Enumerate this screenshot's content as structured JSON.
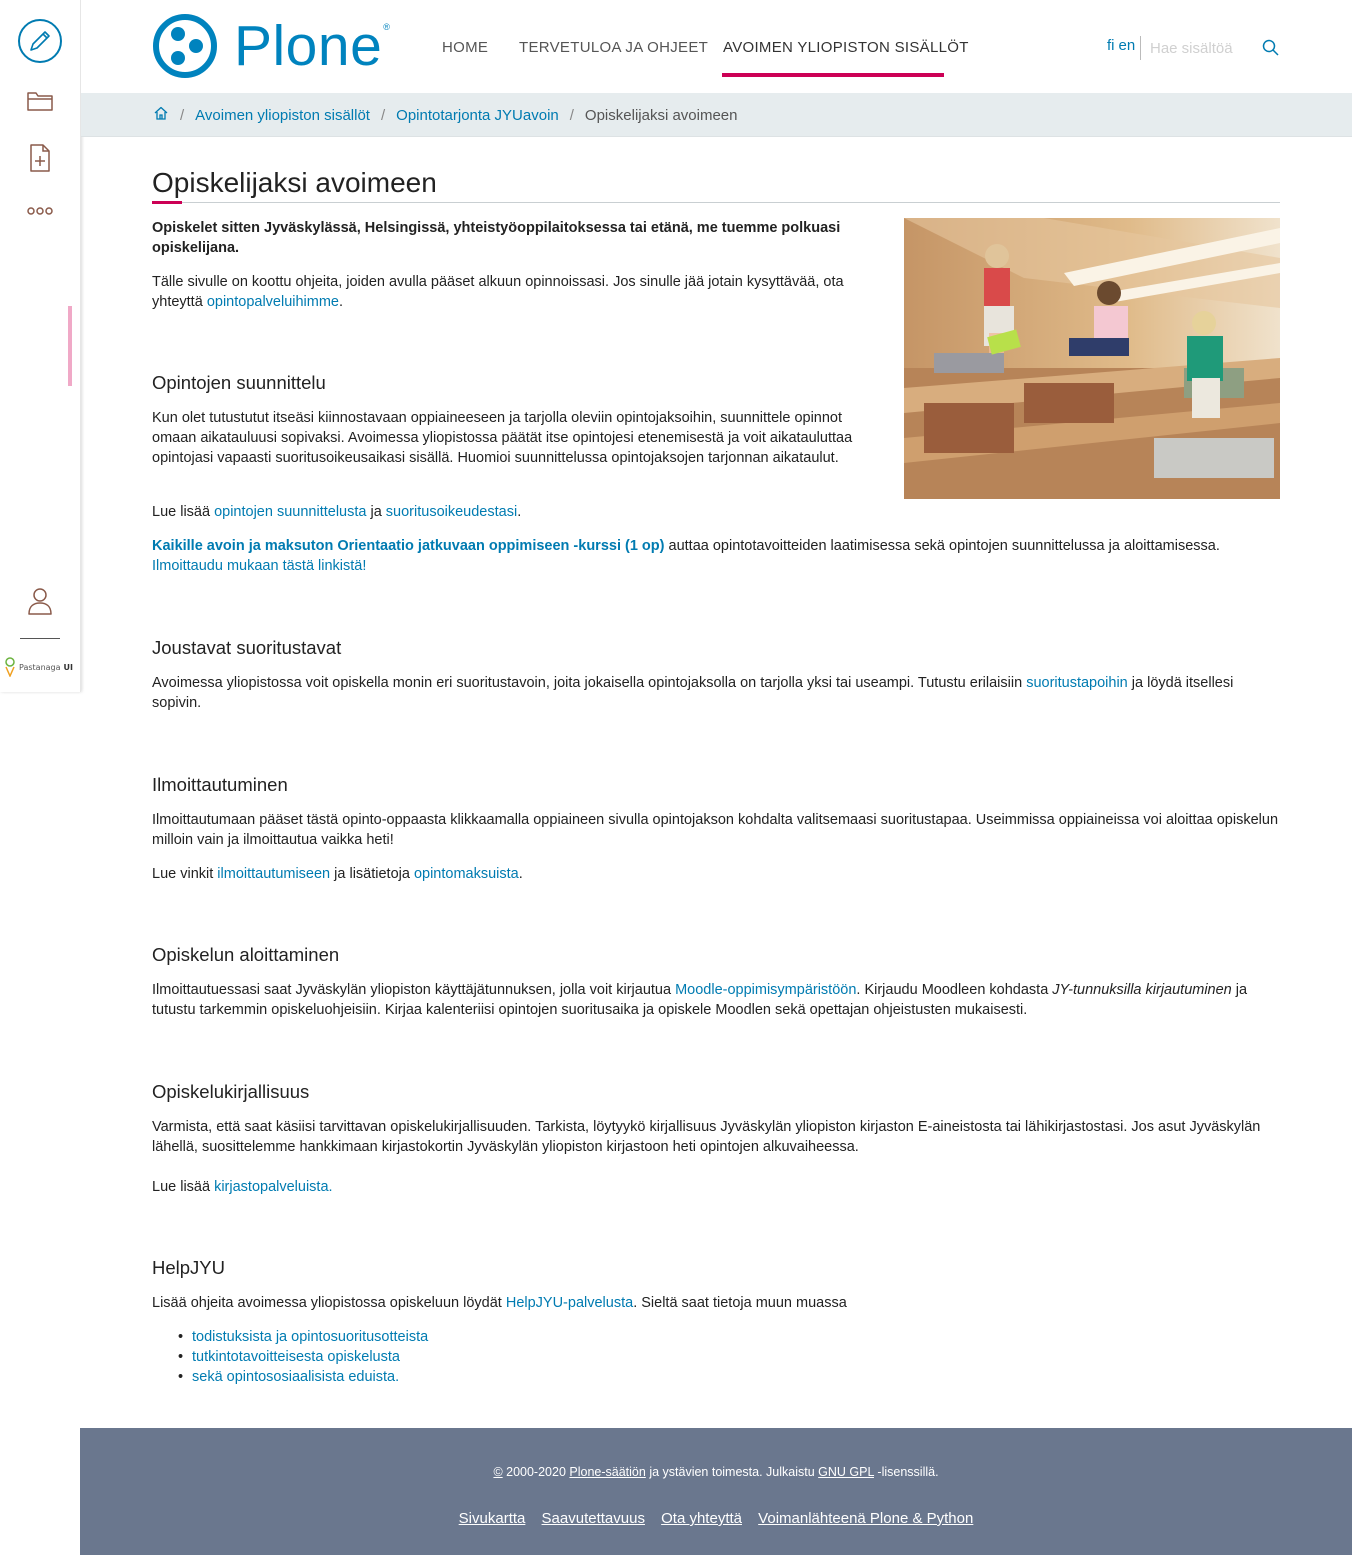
{
  "brand": {
    "name": "Plone",
    "reg": "®"
  },
  "toolbar": {
    "brand_prefix": "Pastanaga",
    "brand_suffix": "UI"
  },
  "nav": {
    "home": "HOME",
    "welcome": "TERVETULOA JA OHJEET",
    "open": "AVOIMEN YLIOPISTON SISÄLLÖT"
  },
  "lang": {
    "fi": "fi",
    "en": "en"
  },
  "search": {
    "placeholder": "Hae sisältöä"
  },
  "breadcrumb": {
    "items": [
      "Avoimen yliopiston sisällöt",
      "Opintotarjonta JYUavoin"
    ],
    "current": "Opiskelijaksi avoimeen"
  },
  "page": {
    "title": "Opiskelijaksi avoimeen",
    "lead": "Opiskelet sitten Jyväskylässä, Helsingissä, yhteistyöoppilaitoksessa tai etänä, me tuemme polkuasi opiskelijana.",
    "intro": {
      "text": "Tälle sivulle on koottu ohjeita, joiden avulla pääset alkuun opinnoissasi. Jos sinulle jää jotain kysyttävää, ota yhteyttä ",
      "link": "opintopalveluihimme",
      "end": "."
    },
    "s1": {
      "heading": "Opintojen suunnittelu",
      "p1": "Kun olet tutustutut itseäsi kiinnostavaan oppiaineeseen ja tarjolla oleviin opintojaksoihin, suunnittele opinnot omaan aikatauluusi sopivaksi. Avoimessa yliopistossa päätät itse opintojesi etenemisestä ja voit aikatauluttaa opintojasi vapaasti suoritusoikeusaikasi sisällä. Huomioi suunnittelussa opintojaksojen tarjonnan aikataulut.",
      "p2_a": "Lue lisää ",
      "p2_link1": "opintojen suunnittelusta",
      "p2_b": " ja ",
      "p2_link2": "suoritusoikeudestasi",
      "p2_c": ".",
      "p3_link_bold": "Kaikille avoin ja maksuton Orientaatio jatkuvaan oppimiseen -kurssi (1 op)",
      "p3_a": " auttaa opintotavoitteiden laatimisessa sekä opintojen suunnittelussa ja aloittamisessa. ",
      "p3_link2": "Ilmoittaudu mukaan tästä linkistä!"
    },
    "s2": {
      "heading": "Joustavat suoritustavat",
      "p1_a": "Avoimessa yliopistossa voit opiskella monin eri suoritustavoin, joita jokaisella opintojaksolla on tarjolla yksi tai useampi. Tutustu erilaisiin ",
      "p1_link": "suoritustapoihin",
      "p1_b": " ja löydä itsellesi sopivin."
    },
    "s3": {
      "heading": "Ilmoittautuminen",
      "p1": "Ilmoittautumaan pääset tästä opinto-oppaasta klikkaamalla oppiaineen sivulla opintojakson kohdalta valitsemaasi suoritustapaa. Useimmissa oppiaineissa voi aloittaa opiskelun milloin vain ja ilmoittautua vaikka heti!",
      "p2_a": "Lue vinkit ",
      "p2_link1": "ilmoittautumiseen",
      "p2_b": " ja lisätietoja ",
      "p2_link2": "opintomaksuista",
      "p2_c": "."
    },
    "s4": {
      "heading": "Opiskelun aloittaminen",
      "p1_a": "Ilmoittautuessasi saat Jyväskylän yliopiston käyttäjätunnuksen, jolla voit kirjautua ",
      "p1_link": "Moodle-oppimisympäristöön",
      "p1_b": ". Kirjaudu Moodleen kohdasta ",
      "p1_em": "JY-tunnuksilla kirjautuminen",
      "p1_c": " ja tutustu tarkemmin opiskeluohjeisiin. Kirjaa kalenteriisi opintojen suoritusaika ja opiskele Moodlen sekä opettajan ohjeistusten mukaisesti."
    },
    "s5": {
      "heading": "Opiskelukirjallisuus",
      "p1": "Varmista, että saat käsiisi tarvittavan opiskelukirjallisuuden. Tarkista, löytyykö kirjallisuus Jyväskylän yliopiston kirjaston E-aineistosta tai lähikirjastostasi. Jos asut Jyväskylän lähellä, suosittelemme hankkimaan kirjastokortin Jyväskylän yliopiston kirjastoon heti opintojen alkuvaiheessa.",
      "p2_a": "Lue lisää ",
      "p2_link": "kirjastopalveluista."
    },
    "s6": {
      "heading": "HelpJYU",
      "p1_a": "Lisää ohjeita avoimessa yliopistossa opiskeluun löydät ",
      "p1_link": "HelpJYU-palvelusta",
      "p1_b": ". Sieltä saat tietoja muun muassa",
      "items": [
        "todistuksista ja opintosuoritusotteista",
        "tutkintotavoitteisesta opiskelusta",
        "sekä opintososiaalisista eduista."
      ]
    }
  },
  "footer": {
    "copy_sym": "©",
    "copy_a": " 2000-2020 ",
    "copy_link1": "Plone-säätiön",
    "copy_b": " ja ystävien toimesta. Julkaistu ",
    "copy_link2": "GNU GPL",
    "copy_c": " -lisenssillä.",
    "links": [
      "Sivukartta",
      "Saavutettavuus",
      "Ota yhteyttä",
      "Voimanlähteenä Plone & Python"
    ]
  },
  "colors": {
    "accent": "#cc0055",
    "link": "#007bb1",
    "brand": "#0083be",
    "footer_bg": "#6a778e",
    "breadcrumb_bg": "#e6ecee"
  },
  "icons": [
    "edit-icon",
    "folder-icon",
    "add-document-icon",
    "more-icon",
    "user-icon",
    "pastanaga-icon",
    "home-icon",
    "search-icon",
    "plone-logo-icon"
  ]
}
